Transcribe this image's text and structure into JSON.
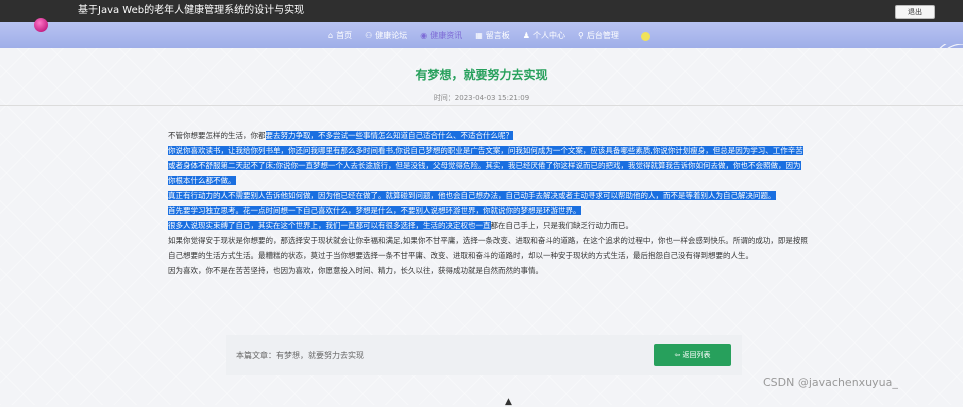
{
  "header": {
    "app_title": "基于Java Web的老年人健康管理系统的设计与实现",
    "logout_label": "退出"
  },
  "nav": {
    "items": [
      {
        "label": "首页",
        "icon": "home-icon",
        "glyph": "⌂"
      },
      {
        "label": "健康论坛",
        "icon": "forum-icon",
        "glyph": "⚇"
      },
      {
        "label": "健康资讯",
        "icon": "news-icon",
        "glyph": "◉"
      },
      {
        "label": "留言板",
        "icon": "message-board-icon",
        "glyph": "▦"
      },
      {
        "label": "个人中心",
        "icon": "user-icon",
        "glyph": "♟"
      },
      {
        "label": "后台管理",
        "icon": "link-icon",
        "glyph": "⚲"
      }
    ],
    "active_index": 2
  },
  "article": {
    "title": "有梦想，就要努力去实现",
    "time": "时间：2023-04-03 15:21:09",
    "paragraphs": [
      [
        {
          "text": "不管你想要怎样的生活，你都",
          "selected": false
        },
        {
          "text": "要去努力争取，不多尝试一些事情怎么知道自己适合什么、不适合什么呢？",
          "selected": true
        }
      ],
      [
        {
          "text": "你说你喜欢读书，让我给你列书单，你还问我哪里有那么多时间看书,你说自己梦想的职业是广告文案，问我如何成为一个文案，应该具备哪些素质,你说你计划瘦身，但总是因为学习、工作辛苦或者身体不舒服第二天起不了床;你说你一直梦想一个人去长途旅行，但是没钱，父母觉得危险。其实，我已经厌倦了你这样说而已的把戏，我觉得就算我告诉你如何去做，你也不会照做，因为你根本什么都不做。",
          "selected": true
        }
      ],
      [
        {
          "text": "真正有行动力的人不需要别人告诉他如何做，因为他已经在做了。就算碰到问题，他也会自己想办法，自己动手去解决或者主动寻求可以帮助他的人，而不是等着别人为自己解决问题。",
          "selected": true
        }
      ],
      [
        {
          "text": "首先要学习独立思考。花一点时间想一下自己喜欢什么，梦想是什么，不要别人说想环游世界，你就说你的梦想是环游世界。",
          "selected": true
        }
      ],
      [
        {
          "text": "很多人说现实束缚了自己，其实在这个世界上，我们一直都可以有很多选择，生活的决定权也一直",
          "selected": true
        },
        {
          "text": "都在自己手上，只是我们缺乏行动力而已。",
          "selected": false
        }
      ],
      [
        {
          "text": "如果你觉得安于现状是你想要的，那选择安于现状就会让你幸福和满足,如果你不甘平庸，选择一条改变、进取和奋斗的道路，在这个追求的过程中，你也一样会感到快乐。所谓的成功，即是按照自己想要的生活方式生活。最糟糕的状态，莫过于当你想要选择一条不甘平庸、改变、进取和奋斗的道路时，却以一种安于现状的方式生活，最后抱怨自己没有得到想要的人生。",
          "selected": false
        }
      ],
      [
        {
          "text": "因为喜欢，你不是在苦苦坚持，也因为喜欢，你愿意投入时间、精力，长久以往，获得成功就是自然而然的事情。",
          "selected": false
        }
      ]
    ]
  },
  "footer_card": {
    "label": "本篇文章：有梦想，就要努力去实现",
    "back_label": "返回列表",
    "back_icon": "arrow-left-icon"
  },
  "watermark": "CSDN @javachenxuyua_",
  "colors": {
    "accent_green": "#27a05c",
    "nav_bg": "#a9b6ee",
    "selection": "#1a6fe0"
  }
}
